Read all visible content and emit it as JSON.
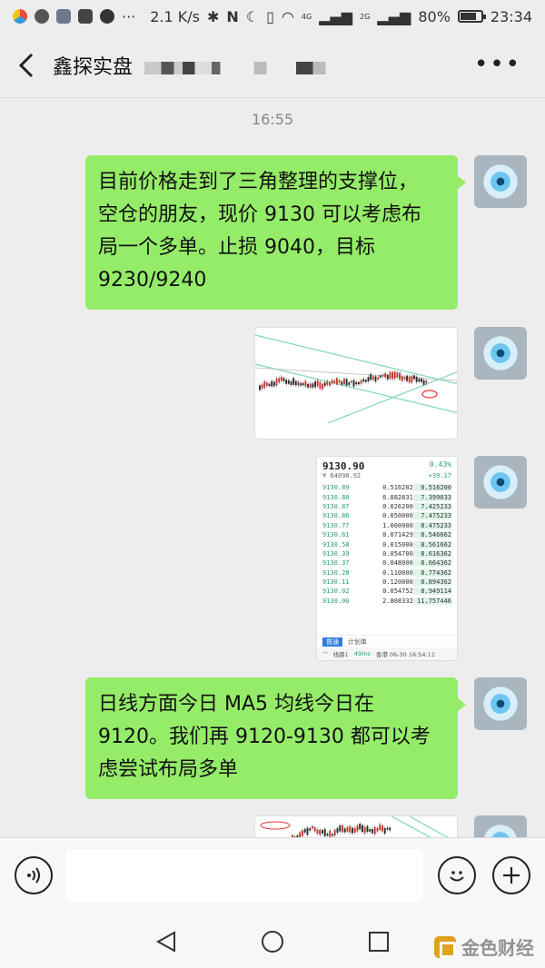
{
  "status_bar": {
    "network_speed": "2.1 K/s",
    "network_type_1": "4G",
    "network_type_2": "2G",
    "battery_percent": "80%",
    "battery_level": 0.8,
    "time": "23:34"
  },
  "header": {
    "back_icon": "chevron-left-icon",
    "title": "鑫探实盘",
    "more_label": "•••"
  },
  "chat": {
    "timestamp": "16:55",
    "messages": [
      {
        "type": "text",
        "text": "目前价格走到了三角整理的支撑位，\n空仓的朋友，现价 9130 可以考虑布\n局一个多单。止损 9040，目标\n9230/9240"
      },
      {
        "type": "image",
        "content": "candlestick-chart-thumbnail"
      },
      {
        "type": "image",
        "content": "order-book-thumbnail"
      },
      {
        "type": "text",
        "text": "日线方面今日 MA5 均线今日在\n9120。我们再 9120-9130 都可以考\n虑尝试布局多单"
      },
      {
        "type": "image",
        "content": "chart-thumbnail-partial"
      }
    ],
    "order_book": {
      "price": "9130.90",
      "change_pct": "0.43%",
      "sub_price": "¥ 64098.92",
      "change_abs": "+39.17",
      "rows": [
        [
          "9130.89",
          "0.516202",
          "0.516200"
        ],
        [
          "9130.88",
          "6.882831",
          "7.399033"
        ],
        [
          "9130.87",
          "0.026200",
          "7.425233"
        ],
        [
          "9130.86",
          "0.050000",
          "7.475233"
        ],
        [
          "9130.77",
          "1.000000",
          "8.475233"
        ],
        [
          "9130.61",
          "0.071429",
          "8.546662"
        ],
        [
          "9130.58",
          "0.015000",
          "8.561662"
        ],
        [
          "9130.39",
          "0.054700",
          "8.616362"
        ],
        [
          "9130.37",
          "0.048000",
          "8.664362"
        ],
        [
          "9130.28",
          "0.110000",
          "8.774362"
        ],
        [
          "9130.11",
          "0.120000",
          "8.894362"
        ],
        [
          "9130.02",
          "0.054752",
          "8.949114"
        ],
        [
          "9130.00",
          "2.808332",
          "11.757446"
        ]
      ],
      "tab_1": "普通",
      "tab_2": "计划单",
      "status_line": "线路1",
      "latency": "49ms",
      "status_time": "香港 06-30 16:54:11"
    }
  },
  "input_bar": {
    "voice_icon": "voice-icon",
    "emoji_icon": "emoji-icon",
    "plus_icon": "plus-icon"
  },
  "nav_bar": {
    "back_icon": "triangle-back-icon",
    "home_icon": "circle-home-icon",
    "recents_icon": "square-recents-icon",
    "watermark_text": "金色财经"
  },
  "colors": {
    "bubble": "#95ec69",
    "background": "#ededed",
    "order_green": "#2aa06a",
    "tab_blue": "#2f7be0"
  }
}
